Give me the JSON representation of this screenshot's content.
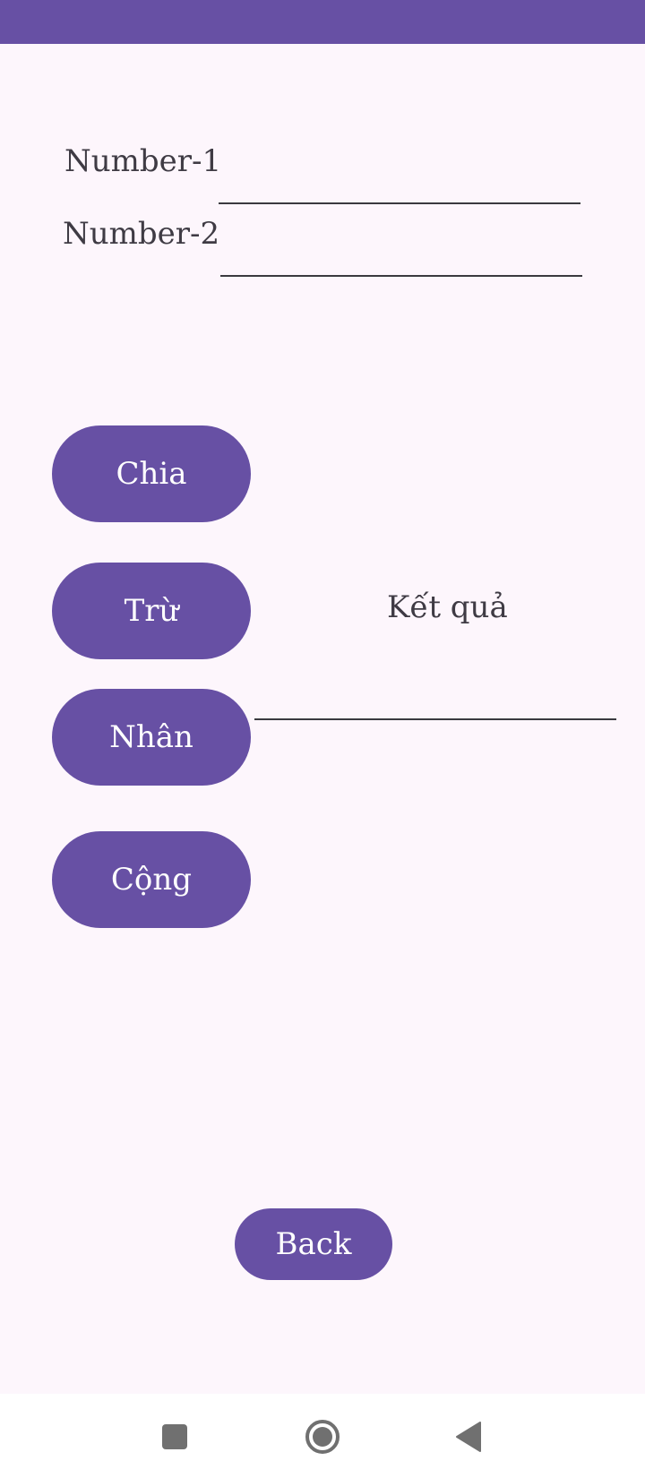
{
  "form": {
    "number1_label": "Number-1",
    "number1_value": "",
    "number2_label": "Number-2",
    "number2_value": ""
  },
  "operations": [
    {
      "label": "Chia"
    },
    {
      "label": "Trừ"
    },
    {
      "label": "Nhân"
    },
    {
      "label": "Cộng"
    }
  ],
  "result": {
    "label": "Kết quả",
    "value": ""
  },
  "back_label": "Back",
  "navigation": {
    "recents_icon": "square-icon",
    "home_icon": "circle-icon",
    "back_icon": "triangle-back-icon"
  },
  "colors": {
    "primary": "#6750a4",
    "background": "#fdf6fc",
    "text": "#3f3b44"
  }
}
